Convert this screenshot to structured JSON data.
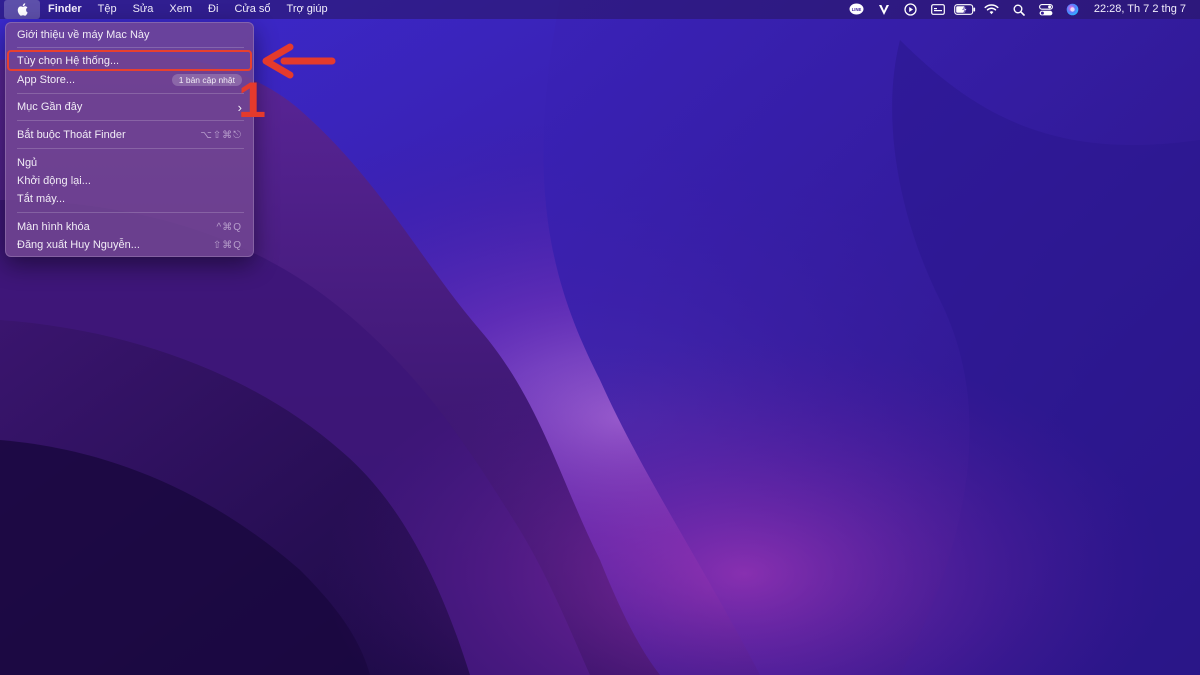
{
  "menubar": {
    "apple_icon": "apple-logo-icon",
    "app_name": "Finder",
    "menus": [
      "Tệp",
      "Sửa",
      "Xem",
      "Đi",
      "Cửa sổ",
      "Trợ giúp"
    ],
    "status_icons": [
      "line-icon",
      "v-app-icon",
      "play-circle-icon",
      "display-icon",
      "battery-charging-icon",
      "wifi-icon",
      "search-icon",
      "control-center-icon",
      "siri-icon"
    ],
    "clock": "22:28, Th 7 2 thg 7"
  },
  "apple_menu": {
    "about": "Giới thiệu về máy Mac Này",
    "system_prefs": "Tùy chọn Hệ thống...",
    "app_store": "App Store...",
    "app_store_badge": "1 bản cập nhật",
    "recent_items": "Mục Gần đây",
    "force_quit": "Bắt buộc Thoát Finder",
    "force_quit_shortcut": "⌥⇧⌘⎋",
    "sleep": "Ngủ",
    "restart": "Khởi động lại...",
    "shutdown": "Tắt máy...",
    "lock_screen": "Màn hình khóa",
    "lock_screen_shortcut": "^⌘Q",
    "logout": "Đăng xuất Huy Nguyễn...",
    "logout_shortcut": "⇧⌘Q"
  },
  "annotation": {
    "step": "1",
    "color": "#e53a2c"
  },
  "colors": {
    "wallpaper_base": "#2a0f6e",
    "wallpaper_glow": "#8e3fc4",
    "highlight": "#e8402e"
  }
}
